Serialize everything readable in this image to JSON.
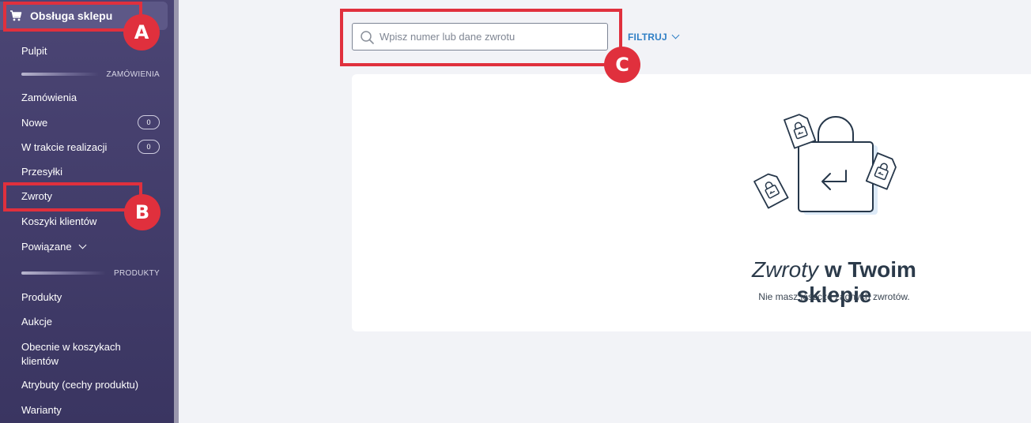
{
  "sidebar": {
    "header": "Obsługa sklepu",
    "items": {
      "pulpit": "Pulpit",
      "zamowienia": "Zamówienia",
      "nowe": "Nowe",
      "nowe_count": "0",
      "w_trakcie": "W trakcie realizacji",
      "w_trakcie_count": "0",
      "przesylki": "Przesyłki",
      "zwroty": "Zwroty",
      "koszyki": "Koszyki klientów",
      "powiazane": "Powiązane",
      "produkty": "Produkty",
      "aukcje": "Aukcje",
      "obecnie_1": "Obecnie w koszykach",
      "obecnie_2": "klientów",
      "atrybuty": "Atrybuty (cechy produktu)",
      "warianty": "Warianty"
    },
    "sections": {
      "zamowienia": "ZAMÓWIENIA",
      "produkty": "PRODUKTY"
    }
  },
  "search": {
    "placeholder": "Wpisz numer lub dane zwrotu",
    "value": ""
  },
  "filter": {
    "label": "FILTRUJ"
  },
  "empty_state": {
    "title_italic": "Zwroty",
    "title_bold": "w Twoim sklepie",
    "subtitle": "Nie masz jeszcze żadnych zwrotów."
  },
  "annotations": {
    "a": "A",
    "b": "B",
    "c": "C"
  },
  "colors": {
    "sidebar_bg": "#4b4574",
    "accent_blue": "#2f7fc5",
    "annotation_red": "#e0303d"
  }
}
